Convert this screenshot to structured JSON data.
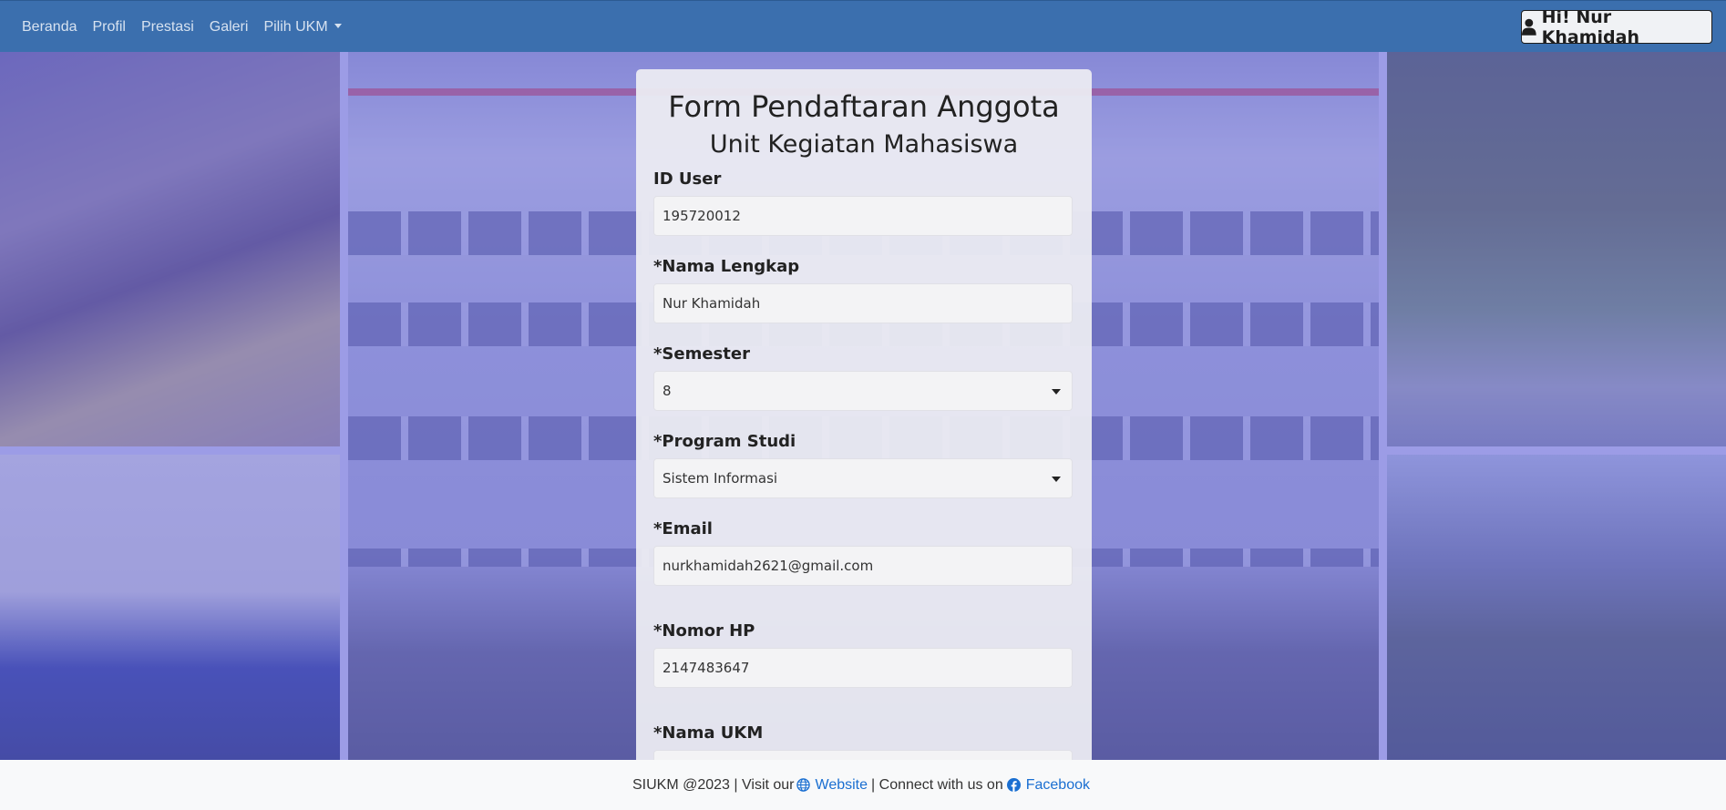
{
  "nav": {
    "links": [
      "Beranda",
      "Profil",
      "Prestasi",
      "Galeri"
    ],
    "dropdown_label": "Pilih UKM",
    "user_greeting": "Hi! Nur Khamidah"
  },
  "form": {
    "title": "Form Pendaftaran Anggota",
    "subtitle": "Unit Kegiatan Mahasiswa",
    "fields": [
      {
        "label": "ID User",
        "value": "195720012",
        "kind": "text"
      },
      {
        "label": "*Nama Lengkap",
        "value": "Nur Khamidah",
        "kind": "text"
      },
      {
        "label": "*Semester",
        "value": "8",
        "kind": "select"
      },
      {
        "label": "*Program Studi",
        "value": "Sistem Informasi",
        "kind": "select"
      },
      {
        "label": "*Email",
        "value": "nurkhamidah2621@gmail.com",
        "kind": "text"
      },
      {
        "label": "*Nomor HP",
        "value": "2147483647",
        "kind": "text"
      },
      {
        "label": "*Nama UKM",
        "value": "",
        "kind": "select"
      }
    ]
  },
  "footer": {
    "prefix": "SIUKM @2023 | Visit our",
    "website_label": "Website",
    "middle": "| Connect with us on",
    "facebook_label": "Facebook"
  },
  "colors": {
    "navbar": "#3b6fae",
    "link": "#1a6fd1",
    "overlay": "#6e6ed7"
  },
  "icons": {
    "user": "user-icon",
    "website": "globe-icon",
    "facebook": "facebook-icon",
    "dropdown": "caret-down-icon"
  }
}
